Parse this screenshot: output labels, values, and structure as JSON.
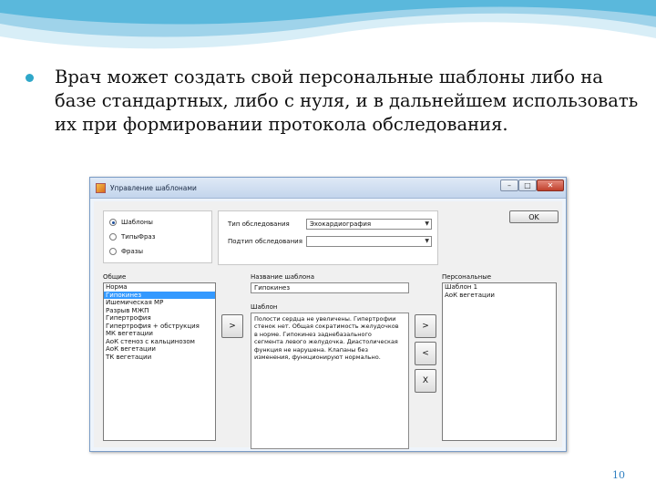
{
  "slide": {
    "text": "Врач может создать свой персональные шаблоны либо на базе стандартных, либо с нуля, и в дальнейшем использовать их при формировании протокола обследования.",
    "page_number": "10",
    "accent_color": "#2fa7c9"
  },
  "window": {
    "title": "Управление шаблонами",
    "minimize_icon": "minimize-icon",
    "maximize_icon": "maximize-icon",
    "close_icon": "close-icon"
  },
  "radios": {
    "items": [
      {
        "label": "Шаблоны",
        "checked": true
      },
      {
        "label": "ТипыФраз",
        "checked": false
      },
      {
        "label": "Фразы",
        "checked": false
      }
    ]
  },
  "params": {
    "type_label": "Тип обследования",
    "type_value": "Эхокардиография",
    "subtype_label": "Подтип обследования",
    "subtype_value": ""
  },
  "ok_label": "OK",
  "general": {
    "label": "Общие",
    "items": [
      "Норма",
      "Гипокинез",
      "Ишемическая МР",
      "Разрыв МЖП",
      "Гипертрофия",
      "Гипертрофия + обструкция",
      "МК вегетации",
      "АоК стеноз с кальцинозом",
      "АоК вегетации",
      "ТК вегетации"
    ],
    "selected_index": 1
  },
  "template": {
    "name_label": "Название шаблона",
    "name_value": "Гипокинез",
    "text_label": "Шаблон",
    "text_lines": [
      "Полости сердца не увеличены. Гипертрофии",
      "стенок нет. Общая сократимость желудочков",
      "в норме. Гипокинез заднебазального",
      "сегмента левого желудочка. Диастолическая",
      "функция не нарушена. Клапаны без",
      "изменения, функционируют нормально."
    ]
  },
  "personal": {
    "label": "Персональные",
    "items": [
      "Шаблон 1",
      "АоК вегетации"
    ]
  },
  "buttons": {
    "copy_to_template": ">",
    "add_to_personal": ">",
    "back": "<",
    "delete": "X"
  }
}
